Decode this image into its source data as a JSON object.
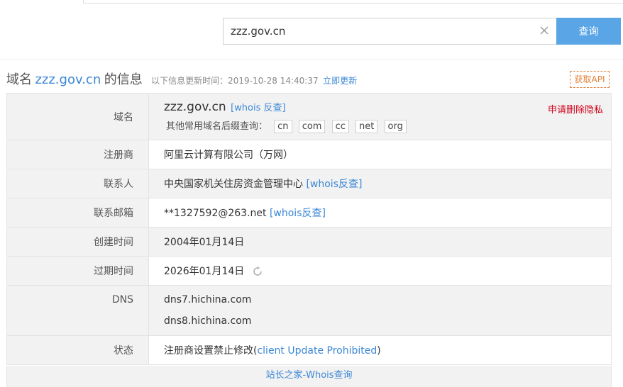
{
  "search": {
    "value": "zzz.gov.cn",
    "button_label": "查询"
  },
  "title": {
    "prefix": "域名",
    "domain": "zzz.gov.cn",
    "suffix": "的信息",
    "update_text": "以下信息更新时间：2019-10-28 14:40:37",
    "refresh_label": "立即更新",
    "api_label": "获取API"
  },
  "domain_row": {
    "label": "域名",
    "name": "zzz.gov.cn",
    "whois_link": "[whois 反查]",
    "privacy_link": "申请删除隐私",
    "suffix_prompt": "其他常用域名后缀查询：",
    "suffixes": [
      "cn",
      "com",
      "cc",
      "net",
      "org"
    ]
  },
  "rows": {
    "registrar": {
      "label": "注册商",
      "value": "阿里云计算有限公司（万网）"
    },
    "contact": {
      "label": "联系人",
      "value": "中央国家机关住房资金管理中心",
      "link": "[whois反查]"
    },
    "email": {
      "label": "联系邮箱",
      "value": "**1327592@263.net",
      "link": "[whois反查]"
    },
    "created": {
      "label": "创建时间",
      "value": "2004年01月14日"
    },
    "expires": {
      "label": "过期时间",
      "value": "2026年01月14日"
    },
    "dns": {
      "label": "DNS",
      "values": [
        "dns7.hichina.com",
        "dns8.hichina.com"
      ]
    },
    "status": {
      "label": "状态",
      "value_prefix": "注册商设置禁止修改(",
      "value_link": "client Update Prohibited",
      "value_suffix": ")"
    }
  },
  "footer": {
    "link": "站长之家-Whois查询"
  },
  "colors": {
    "accent": "#3b87d6",
    "button": "#5aa5e6",
    "warning": "#d0021b",
    "api": "#e0823a",
    "row_gray": "#f2f2f2"
  }
}
